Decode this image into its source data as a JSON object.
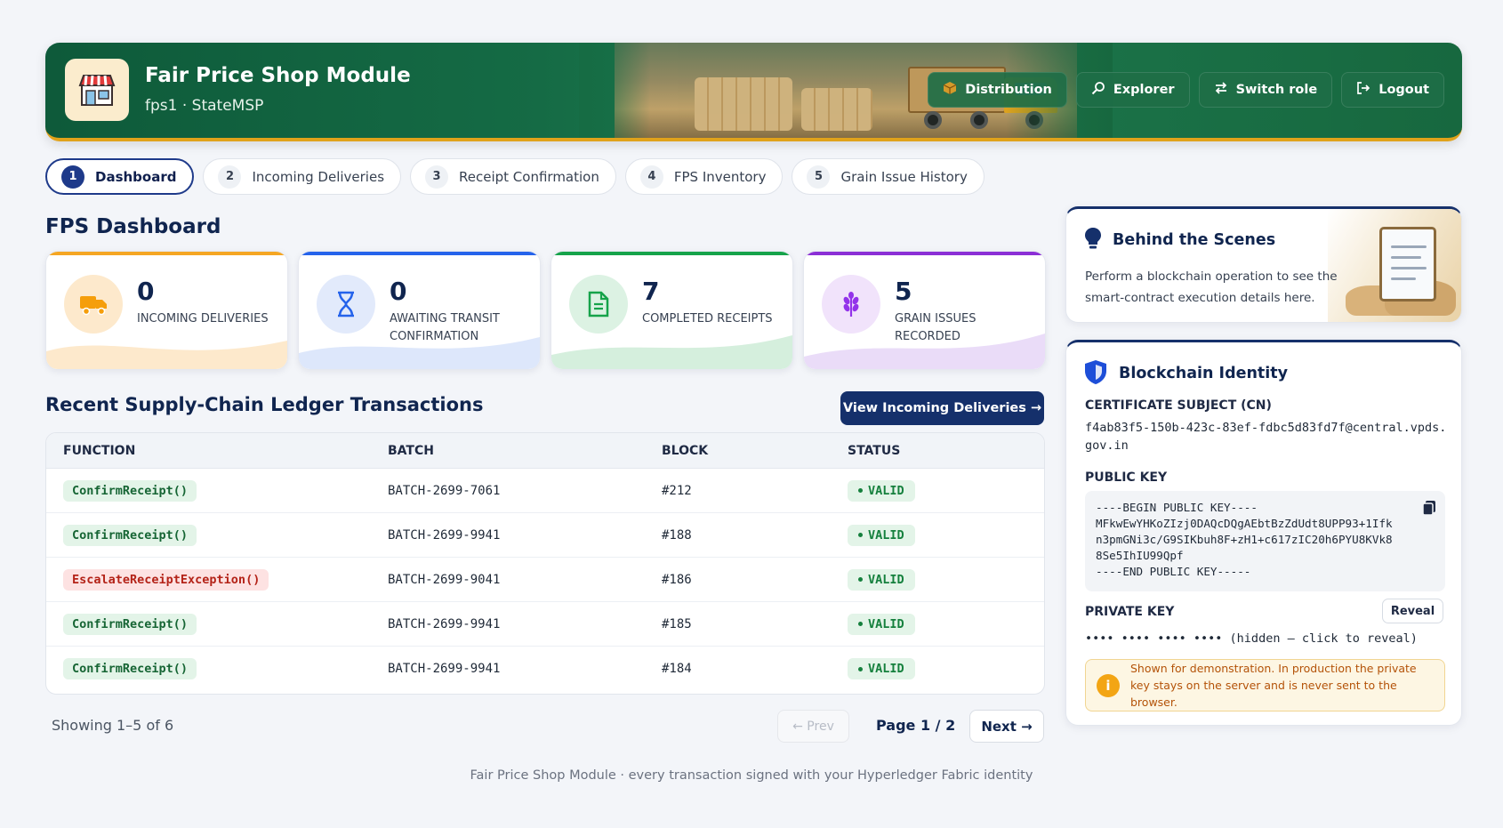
{
  "header": {
    "title": "Fair Price Shop Module",
    "subtitle": "fps1 · StateMSP",
    "buttons": [
      {
        "label": "Distribution",
        "icon": "package-icon"
      },
      {
        "label": "Explorer",
        "icon": "search-icon"
      },
      {
        "label": "Switch role",
        "icon": "swap-icon"
      },
      {
        "label": "Logout",
        "icon": "logout-icon"
      }
    ],
    "accent_color": "#e0a21a",
    "bg_color": "#17683f"
  },
  "tabs": [
    {
      "num": "1",
      "label": "Dashboard",
      "active": true
    },
    {
      "num": "2",
      "label": "Incoming Deliveries"
    },
    {
      "num": "3",
      "label": "Receipt Confirmation"
    },
    {
      "num": "4",
      "label": "FPS Inventory"
    },
    {
      "num": "5",
      "label": "Grain Issue History"
    }
  ],
  "dashboard": {
    "title": "FPS Dashboard",
    "stats": [
      {
        "value": "0",
        "label": "INCOMING DELIVERIES",
        "icon": "truck-icon",
        "color": "#f59e0b"
      },
      {
        "value": "0",
        "label": "AWAITING TRANSIT CONFIRMATION",
        "icon": "hourglass-icon",
        "color": "#2563eb"
      },
      {
        "value": "7",
        "label": "COMPLETED RECEIPTS",
        "icon": "document-icon",
        "color": "#16a34a"
      },
      {
        "value": "5",
        "label": "GRAIN ISSUES RECORDED",
        "icon": "grain-icon",
        "color": "#9333ea"
      }
    ]
  },
  "ledger": {
    "title": "Recent Supply-Chain Ledger Transactions",
    "view_button": "View Incoming Deliveries →",
    "columns": [
      "FUNCTION",
      "BATCH",
      "BLOCK",
      "STATUS"
    ],
    "rows": [
      {
        "fn": "ConfirmReceipt()",
        "batch": "BATCH-2699-7061",
        "block": "#212",
        "status": "VALID",
        "error": false
      },
      {
        "fn": "ConfirmReceipt()",
        "batch": "BATCH-2699-9941",
        "block": "#188",
        "status": "VALID",
        "error": false
      },
      {
        "fn": "EscalateReceiptException()",
        "batch": "BATCH-2699-9041",
        "block": "#186",
        "status": "VALID",
        "error": true
      },
      {
        "fn": "ConfirmReceipt()",
        "batch": "BATCH-2699-9941",
        "block": "#185",
        "status": "VALID",
        "error": false
      },
      {
        "fn": "ConfirmReceipt()",
        "batch": "BATCH-2699-9941",
        "block": "#184",
        "status": "VALID",
        "error": false
      }
    ],
    "showing": "Showing 1–5 of 6",
    "prev_label": "← Prev",
    "page_info": "Page 1 / 2",
    "next_label": "Next →"
  },
  "footer": "Fair Price Shop Module · every transaction signed with your Hyperledger Fabric identity",
  "behind_scenes": {
    "title": "Behind the Scenes",
    "text": "Perform a blockchain operation to see the smart-contract execution details here."
  },
  "identity": {
    "title": "Blockchain Identity",
    "cn_label": "CERTIFICATE SUBJECT (CN)",
    "cn_value": "f4ab83f5-150b-423c-83ef-fdbc5d83fd7f@central.vpds.gov.in",
    "pubkey_label": "PUBLIC KEY",
    "pubkey_lines": [
      "----BEGIN PUBLIC KEY----",
      "MFkwEwYHKoZIzj0DAQcDQgAEbtBzZdUdt8UPP93+1Ifk",
      "n3pmGNi3c/G9SIKbuh8F+zH1+c617zIC20h6PYU8KVk8",
      "8Se5IhIU99Qpf",
      "----END PUBLIC KEY-----"
    ],
    "privkey_label": "PRIVATE KEY",
    "reveal_label": "Reveal",
    "privkey_value": "•••• •••• •••• •••• (hidden — click to reveal)",
    "warning": "Shown for demonstration. In production the private key stays on the server and is never sent to the browser."
  }
}
